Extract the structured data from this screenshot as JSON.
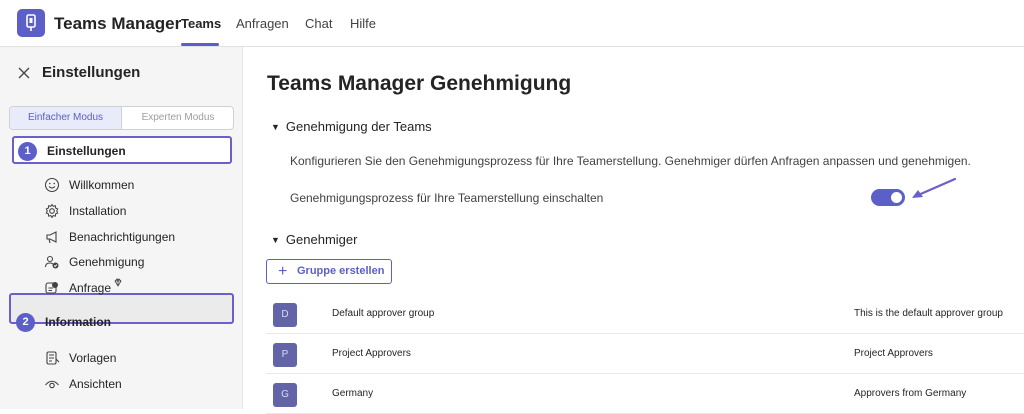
{
  "header": {
    "app_title": "Teams Manager",
    "tabs": [
      {
        "label": "Teams",
        "active": true
      },
      {
        "label": "Anfragen",
        "active": false
      },
      {
        "label": "Chat",
        "active": false
      },
      {
        "label": "Hilfe",
        "active": false
      }
    ]
  },
  "sidebar": {
    "title": "Einstellungen",
    "modes": {
      "simple": "Einfacher Modus",
      "expert": "Experten Modus"
    },
    "step1": {
      "number": "1",
      "label": "Einstellungen"
    },
    "step1_items": [
      {
        "label": "Willkommen",
        "icon": "smiley-icon"
      },
      {
        "label": "Installation",
        "icon": "gear-icon"
      },
      {
        "label": "Benachrichtigungen",
        "icon": "megaphone-icon"
      },
      {
        "label": "Genehmigung",
        "icon": "people-check-icon",
        "selected": true
      },
      {
        "label": "Anfrage",
        "icon": "request-icon",
        "badge_icon": "diamond-icon"
      }
    ],
    "step2": {
      "number": "2",
      "label": "Information"
    },
    "step2_items": [
      {
        "label": "Vorlagen",
        "icon": "template-icon"
      },
      {
        "label": "Ansichten",
        "icon": "eye-icon"
      }
    ]
  },
  "main": {
    "title": "Teams Manager Genehmigung",
    "section1": {
      "label": "Genehmigung der Teams",
      "description": "Konfigurieren Sie den Genehmigungsprozess für Ihre Teamerstellung. Genehmiger dürfen Anfragen anpassen und genehmigen.",
      "toggle_label": "Genehmigungsprozess für Ihre Teamerstellung einschalten",
      "toggle_on": true
    },
    "section2": {
      "label": "Genehmiger",
      "add_button": "Gruppe erstellen",
      "groups": [
        {
          "initial": "D",
          "name": "Default approver group",
          "description": "This is the default approver group"
        },
        {
          "initial": "P",
          "name": "Project Approvers",
          "description": "Project Approvers"
        },
        {
          "initial": "G",
          "name": "Germany",
          "description": "Approvers from Germany"
        }
      ]
    }
  },
  "colors": {
    "accent": "#5b5fc7",
    "highlight_border": "#6b5fc9",
    "avatar": "#6264a7"
  }
}
